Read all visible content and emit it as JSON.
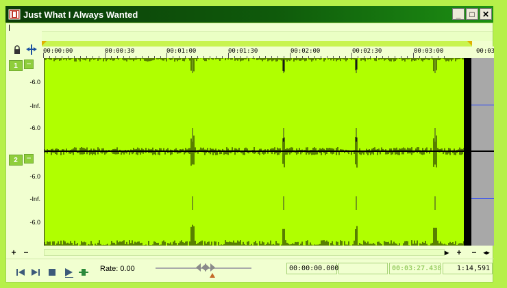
{
  "window": {
    "title": "Just What I Always Wanted",
    "buttons": {
      "minimize": "_",
      "maximize": "□",
      "close": "✕"
    }
  },
  "ruler": {
    "labels": [
      "00:00:00",
      "00:00:30",
      "00:01:00",
      "00:01:30",
      "00:02:00",
      "00:02:30",
      "00:03:00",
      "00:03"
    ]
  },
  "tracks": [
    {
      "number": "1",
      "db_labels": [
        "-6.0",
        "-Inf.",
        "-6.0"
      ]
    },
    {
      "number": "2",
      "db_labels": [
        "-6.0",
        "-Inf.",
        "-6.0"
      ]
    }
  ],
  "scroll": {
    "zoom_in": "+",
    "zoom_out": "−",
    "left": "◂",
    "right": "▸"
  },
  "transport": {
    "rate_label": "Rate: 0.00",
    "cursor_time": "00:00:00.000",
    "selection": "",
    "length": "00:03:27.438",
    "frame": "1:14,591"
  },
  "colors": {
    "waveform": "#b0ff00",
    "background": "#f1ffd0",
    "title_bar": "#0f5a0b",
    "playhead_marker": "#c46a2a"
  }
}
